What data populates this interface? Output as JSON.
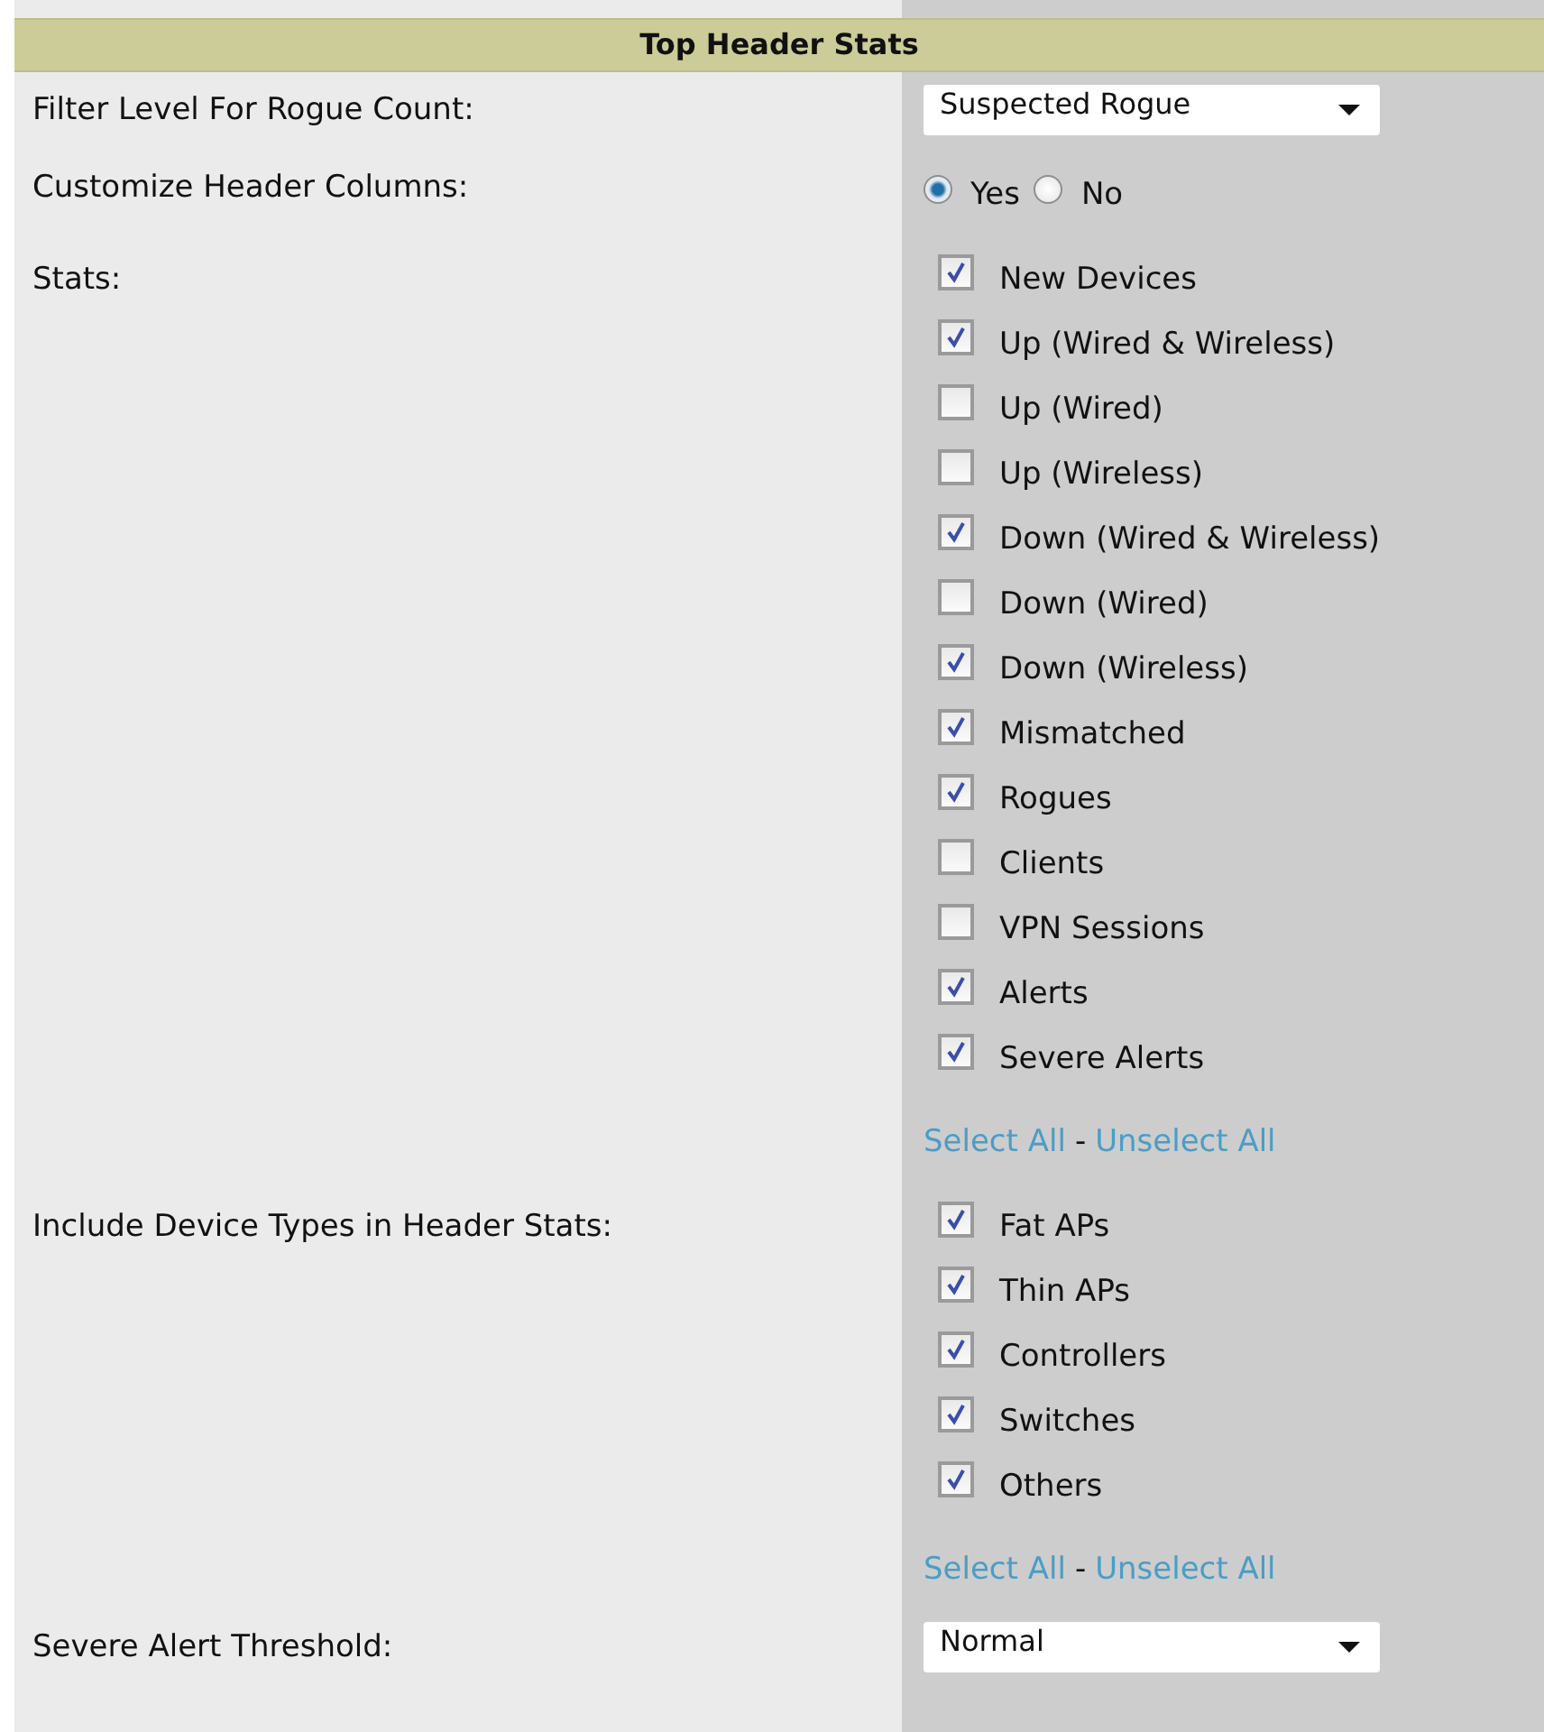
{
  "section": {
    "title": "Top Header Stats"
  },
  "rows": [
    {
      "kind": "dropdown",
      "label": "Filter Level For Rogue Count:",
      "value": "Suspected Rogue"
    },
    {
      "kind": "radio",
      "label": "Customize Header Columns:",
      "options": [
        {
          "label": "Yes",
          "selected": true
        },
        {
          "label": "No",
          "selected": false
        }
      ]
    },
    {
      "kind": "checklist",
      "label": "Stats:",
      "items": [
        {
          "label": "New Devices",
          "checked": true
        },
        {
          "label": "Up (Wired & Wireless)",
          "checked": true
        },
        {
          "label": "Up (Wired)",
          "checked": false
        },
        {
          "label": "Up (Wireless)",
          "checked": false
        },
        {
          "label": "Down (Wired & Wireless)",
          "checked": true
        },
        {
          "label": "Down (Wired)",
          "checked": false
        },
        {
          "label": "Down (Wireless)",
          "checked": true
        },
        {
          "label": "Mismatched",
          "checked": true
        },
        {
          "label": "Rogues",
          "checked": true
        },
        {
          "label": "Clients",
          "checked": false
        },
        {
          "label": "VPN Sessions",
          "checked": false
        },
        {
          "label": "Alerts",
          "checked": true
        },
        {
          "label": "Severe Alerts",
          "checked": true
        }
      ],
      "links": [
        "Select All",
        "Unselect All"
      ],
      "separator": "-"
    },
    {
      "kind": "checklist",
      "label": "Include Device Types in Header Stats:",
      "items": [
        {
          "label": "Fat APs",
          "checked": true
        },
        {
          "label": "Thin APs",
          "checked": true
        },
        {
          "label": "Controllers",
          "checked": true
        },
        {
          "label": "Switches",
          "checked": true
        },
        {
          "label": "Others",
          "checked": true
        }
      ],
      "links": [
        "Select All",
        "Unselect All"
      ],
      "separator": "-"
    },
    {
      "kind": "dropdown",
      "label": "Severe Alert Threshold:",
      "value": "Normal"
    }
  ]
}
